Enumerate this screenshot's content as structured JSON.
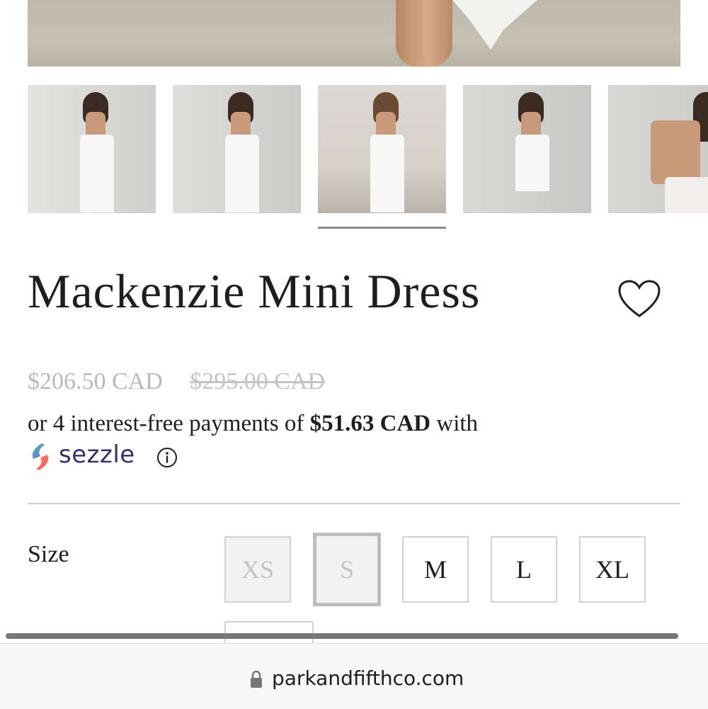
{
  "product": {
    "title": "Mackenzie Mini Dress",
    "sale_price": "$206.50 CAD",
    "original_price": "$295.00 CAD"
  },
  "installment": {
    "prefix": "or 4 interest-free payments of ",
    "amount": "$51.63 CAD",
    "suffix": " with",
    "provider": "sezzle"
  },
  "gallery": {
    "active_thumbnail": 3,
    "thumbnail_count": 5
  },
  "size": {
    "label": "Size",
    "options": [
      {
        "label": "XS",
        "state": "unavailable"
      },
      {
        "label": "S",
        "state": "selected-unavailable"
      },
      {
        "label": "M",
        "state": "available"
      },
      {
        "label": "L",
        "state": "available"
      },
      {
        "label": "XL",
        "state": "available"
      }
    ]
  },
  "browser": {
    "url": "parkandfifthco.com"
  },
  "colors": {
    "accent_sezzle": "#392d6e",
    "muted_price": "#b8b8b8",
    "text": "#1e1e1e"
  }
}
